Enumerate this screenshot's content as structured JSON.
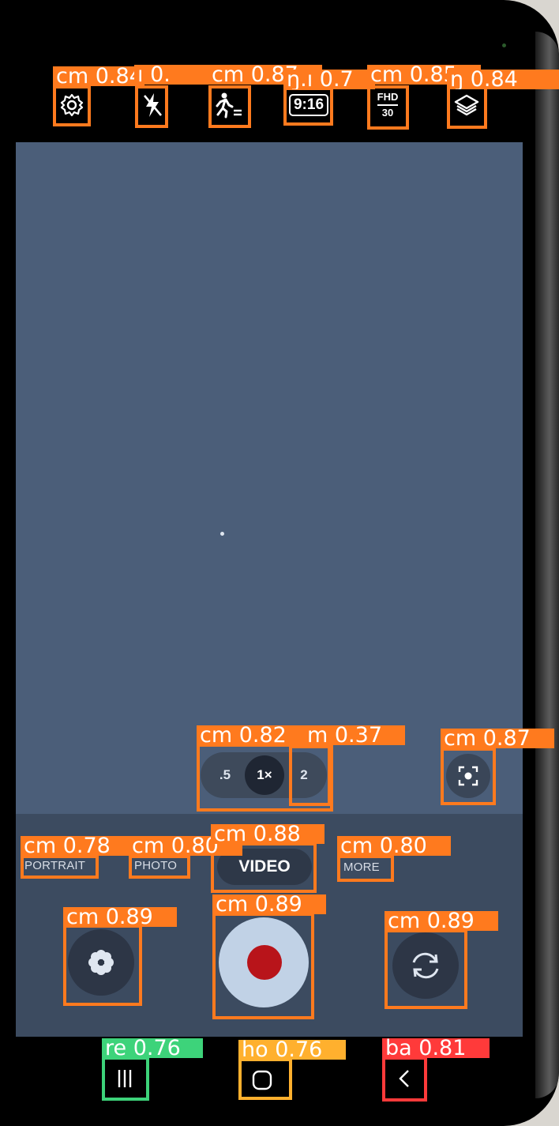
{
  "top_bar": {
    "settings": {
      "icon": "gear-icon"
    },
    "flash": {
      "icon": "flash-off-icon"
    },
    "motion": {
      "icon": "motion-icon"
    },
    "ratio": {
      "label": "9:16"
    },
    "resolution": {
      "line1": "FHD",
      "line2": "30"
    },
    "filters": {
      "icon": "layers-icon"
    }
  },
  "zoom": {
    "options": [
      ".5",
      "1×",
      "2"
    ],
    "active_index": 1
  },
  "focus_button": {
    "icon": "focus-frame-icon"
  },
  "modes": {
    "portrait": "PORTRAIT",
    "photo": "PHOTO",
    "video": "VIDEO",
    "more": "MORE",
    "active": "VIDEO"
  },
  "controls": {
    "effects": {
      "icon": "flower-icon"
    },
    "shutter": {
      "icon": "record-icon",
      "dot_color": "#b8141a"
    },
    "switch_camera": {
      "icon": "rotate-camera-icon"
    }
  },
  "navigation": {
    "recents": {
      "icon": "recents-icon"
    },
    "home": {
      "icon": "home-icon"
    },
    "back": {
      "icon": "back-icon"
    }
  },
  "detections": {
    "colors": {
      "cm": "#ff7a1e",
      "recents": "#3dd37a",
      "home": "#ffb02e",
      "back": "#ff3a3a"
    },
    "labels": {
      "settings": "cm 0.84",
      "flash": "ı 0.",
      "motion": "cm 0.87",
      "ratio": "ŋ.ı 0.7",
      "resolution": "cm 0.85",
      "filters": "ŋ 0.84",
      "zoom_group": "cm 0.82",
      "zoom_two": "m 0.37",
      "focus": "cm 0.87",
      "portrait": "cm 0.78",
      "photo": "cm 0.80",
      "video": "cm 0.88",
      "more": "cm 0.80",
      "effects": "cm 0.89",
      "shutter": "cm 0.89",
      "switch_camera": "cm 0.89",
      "recents": "re 0.76",
      "home": "ho 0.76",
      "back": "ba 0.81"
    }
  }
}
